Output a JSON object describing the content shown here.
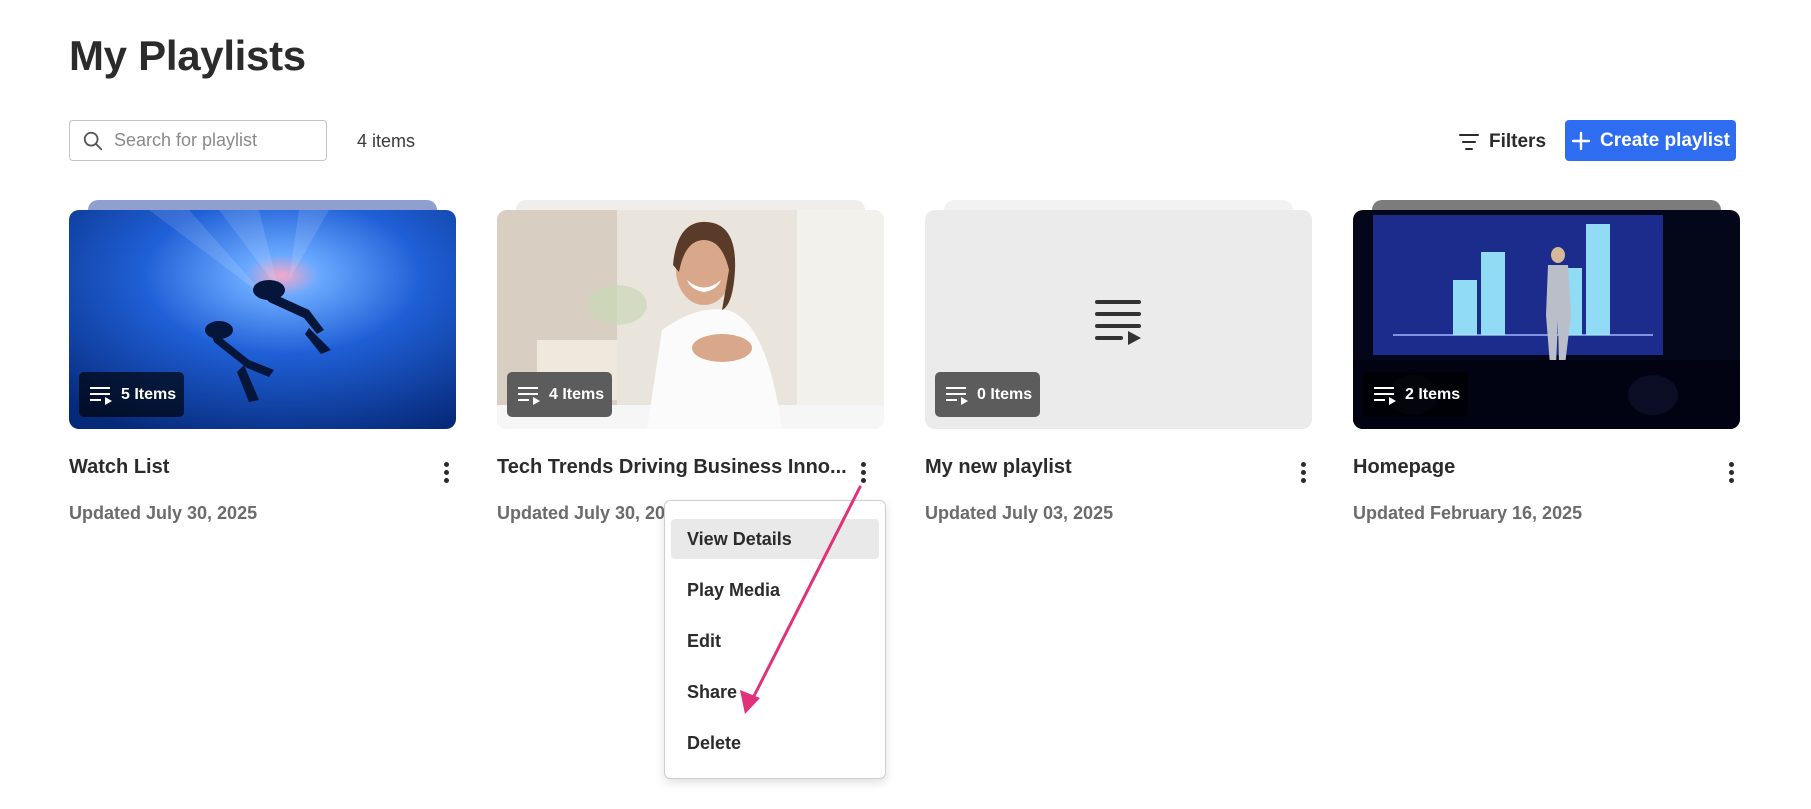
{
  "page": {
    "title": "My Playlists"
  },
  "toolbar": {
    "search_placeholder": "Search for playlist",
    "item_count": "4 items",
    "filters_label": "Filters",
    "create_label": "Create playlist"
  },
  "colors": {
    "accent": "#2f6df0",
    "annotation_arrow": "#e0317a"
  },
  "playlists": [
    {
      "title": "Watch List",
      "items_label": "5 Items",
      "updated": "Updated July 30, 2025",
      "thumbnail": "underwater-divers-image"
    },
    {
      "title": "Tech Trends Driving Business Inno...",
      "items_label": "4 Items",
      "updated": "Updated July 30, 2025",
      "thumbnail": "smiling-woman-image"
    },
    {
      "title": "My new playlist",
      "items_label": "0 Items",
      "updated": "Updated July 03, 2025",
      "thumbnail": "playlist-placeholder-icon"
    },
    {
      "title": "Homepage",
      "items_label": "2 Items",
      "updated": "Updated February 16, 2025",
      "thumbnail": "stage-presentation-image"
    }
  ],
  "context_menu": {
    "items": [
      "View Details",
      "Play Media",
      "Edit",
      "Share",
      "Delete"
    ],
    "highlighted": "View Details"
  }
}
